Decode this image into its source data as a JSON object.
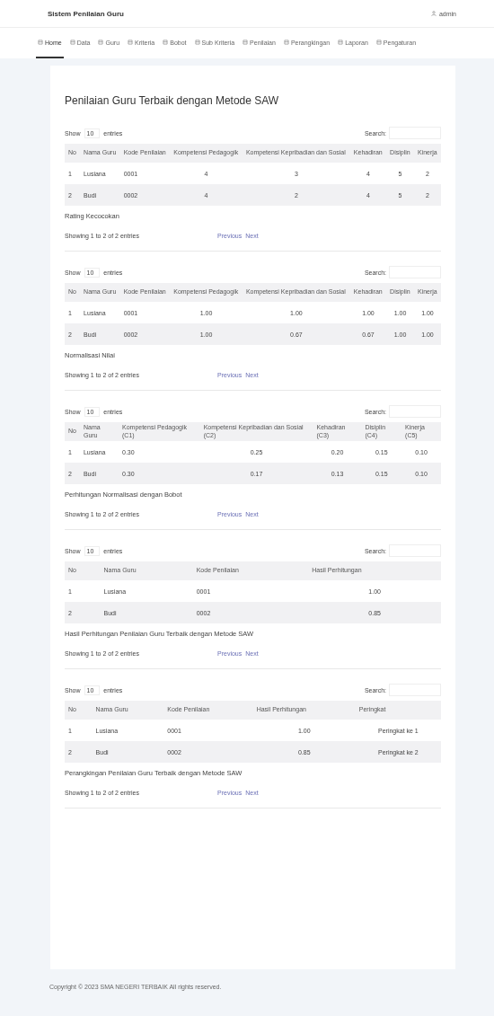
{
  "header": {
    "brand": "Sistem Penilaian Guru",
    "user": "admin"
  },
  "nav": [
    {
      "label": "Home",
      "selected": true
    },
    {
      "label": "Data",
      "selected": false
    },
    {
      "label": "Guru",
      "selected": false
    },
    {
      "label": "Kriteria",
      "selected": false
    },
    {
      "label": "Bobot",
      "selected": false
    },
    {
      "label": "Sub Kriteria",
      "selected": false
    },
    {
      "label": "Penilaian",
      "selected": false
    },
    {
      "label": "Perangkingan",
      "selected": false
    },
    {
      "label": "Laporan",
      "selected": false
    },
    {
      "label": "Pengaturan",
      "selected": false
    }
  ],
  "page_title": "Penilaian Guru Terbaik dengan Metode SAW",
  "sections": [
    {
      "length_label": "Show",
      "length_value": "10",
      "entries_label": "entries",
      "search_label": "Search:",
      "columns": [
        "No",
        "Nama Guru",
        "Kode Penilaian",
        "Kompetensi Pedagogik",
        "Kompetensi Kepribadian dan Sosial",
        "Kehadiran",
        "Disiplin",
        "Kinerja"
      ],
      "rows": [
        [
          "1",
          "Lusiana",
          "0001",
          "4",
          "3",
          "4",
          "5",
          "2"
        ],
        [
          "2",
          "Budi",
          "0002",
          "4",
          "2",
          "4",
          "5",
          "2"
        ]
      ],
      "caption": "Rating Kecocokan",
      "info": "Showing 1 to 2 of 2 entries",
      "previous": "Previous",
      "next": "Next"
    },
    {
      "length_label": "Show",
      "length_value": "10",
      "entries_label": "entries",
      "search_label": "Search:",
      "columns": [
        "No",
        "Nama Guru",
        "Kode Penilaian",
        "Kompetensi Pedagogik",
        "Kompetensi Kepribadian dan Sosial",
        "Kehadiran",
        "Disiplin",
        "Kinerja"
      ],
      "rows": [
        [
          "1",
          "Lusiana",
          "0001",
          "1.00",
          "1.00",
          "1.00",
          "1.00",
          "1.00"
        ],
        [
          "2",
          "Budi",
          "0002",
          "1.00",
          "0.67",
          "0.67",
          "1.00",
          "1.00"
        ]
      ],
      "caption": "Normalisasi Nilai",
      "info": "Showing 1 to 2 of 2 entries",
      "previous": "Previous",
      "next": "Next"
    },
    {
      "length_label": "Show",
      "length_value": "10",
      "entries_label": "entries",
      "search_label": "Search:",
      "columns": [
        "No",
        "Nama Guru",
        "Kompetensi Pedagogik (C1)",
        "Kompetensi Kepribadian dan Sosial (C2)",
        "Kehadiran (C3)",
        "Disiplin (C4)",
        "Kinerja (C5)"
      ],
      "rows": [
        [
          "1",
          "Lusiana",
          "0.30",
          "0.25",
          "0.20",
          "0.15",
          "0.10"
        ],
        [
          "2",
          "Budi",
          "0.30",
          "0.17",
          "0.13",
          "0.15",
          "0.10"
        ]
      ],
      "caption": "Perhitungan Normalisasi dengan Bobot",
      "info": "Showing 1 to 2 of 2 entries",
      "previous": "Previous",
      "next": "Next"
    },
    {
      "length_label": "Show",
      "length_value": "10",
      "entries_label": "entries",
      "search_label": "Search:",
      "columns": [
        "No",
        "Nama Guru",
        "Kode Penilaian",
        "Hasil Perhitungan"
      ],
      "rows": [
        [
          "1",
          "Lusiana",
          "0001",
          "1.00"
        ],
        [
          "2",
          "Budi",
          "0002",
          "0.85"
        ]
      ],
      "caption": "Hasil Perhitungan Penilaian Guru Terbaik dengan Metode SAW",
      "info": "Showing 1 to 2 of 2 entries",
      "previous": "Previous",
      "next": "Next"
    },
    {
      "length_label": "Show",
      "length_value": "10",
      "entries_label": "entries",
      "search_label": "Search:",
      "columns": [
        "No",
        "Nama Guru",
        "Kode Penilaian",
        "Hasil Perhitungan",
        "Peringkat"
      ],
      "rows": [
        [
          "1",
          "Lusiana",
          "0001",
          "1.00",
          "Peringkat ke 1"
        ],
        [
          "2",
          "Budi",
          "0002",
          "0.85",
          "Peringkat ke 2"
        ]
      ],
      "caption": "Perangkingan Penilaian Guru Terbaik dengan Metode SAW",
      "info": "Showing 1 to 2 of 2 entries",
      "previous": "Previous",
      "next": "Next"
    }
  ],
  "footer": "Copyright © 2023 SMA NEGERI TERBAIK All rights reserved."
}
